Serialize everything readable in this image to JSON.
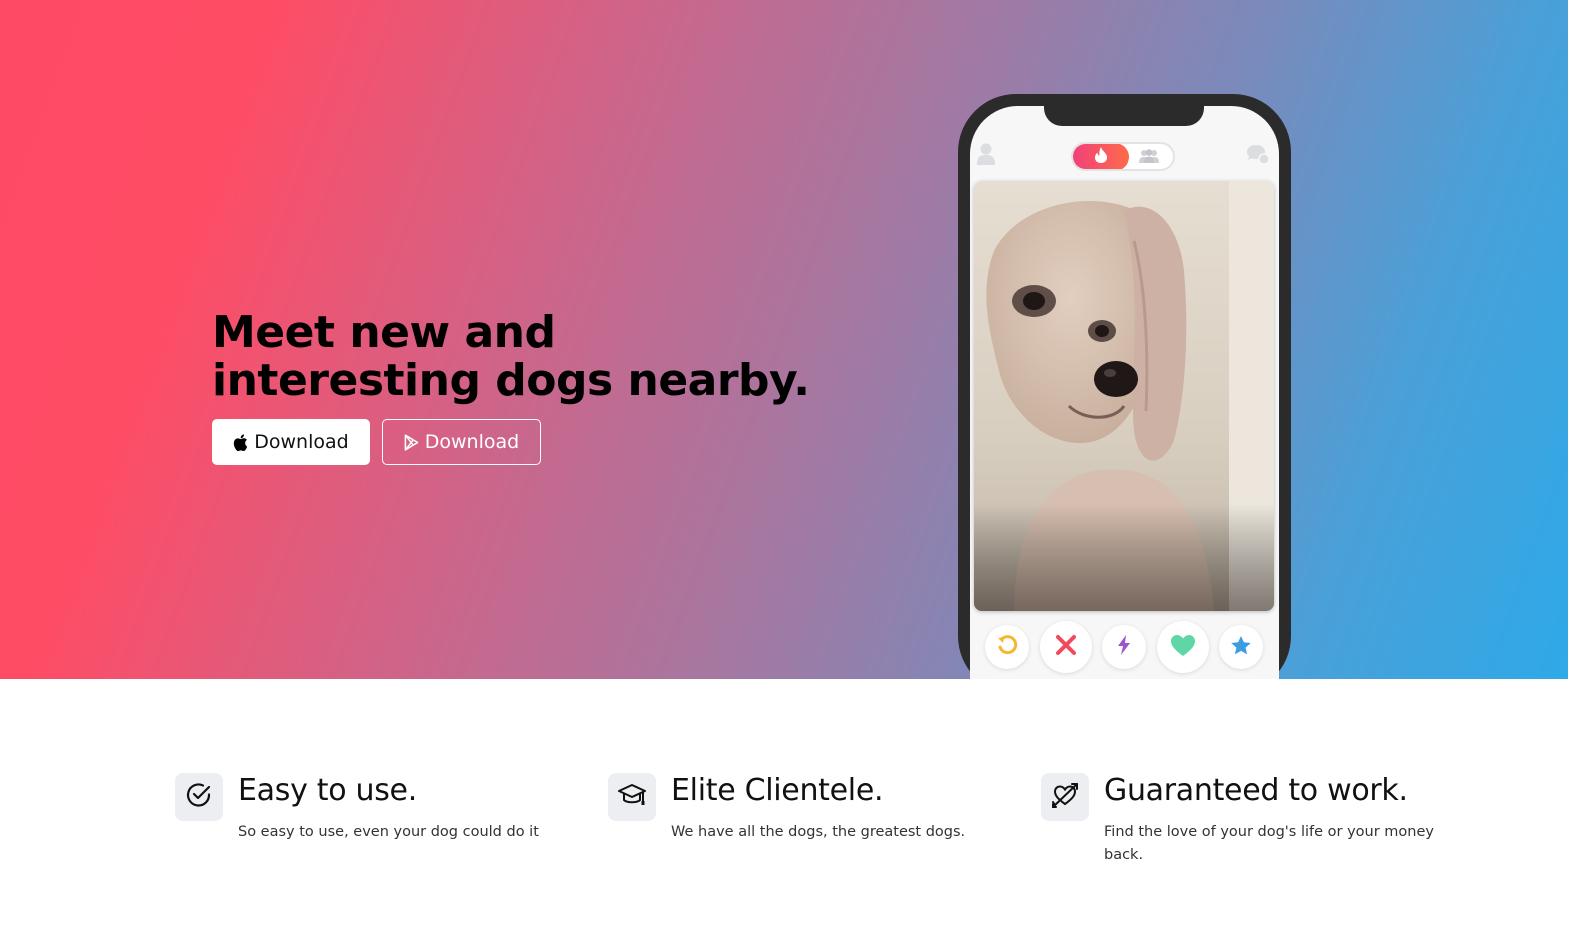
{
  "hero": {
    "title": "Meet new and interesting dogs nearby.",
    "buttons": [
      {
        "label": "Download",
        "icon": "apple-icon"
      },
      {
        "label": "Download",
        "icon": "google-play-icon"
      }
    ],
    "gradient_colors": [
      "#ff4a66",
      "#2ea9e8"
    ]
  },
  "phone": {
    "top_bar": {
      "left_icon": "profile-icon",
      "toggle_active_icon": "flame-icon",
      "toggle_inactive_icon": "group-icon",
      "right_icon": "chat-icon"
    },
    "card": {
      "image": "dog-photo"
    },
    "actions": [
      {
        "icon": "rewind-icon",
        "color": "#f5b731"
      },
      {
        "icon": "close-icon",
        "color": "#f2495c"
      },
      {
        "icon": "boost-icon",
        "color": "#9a55cf"
      },
      {
        "icon": "heart-icon",
        "color": "#5fd6a5"
      },
      {
        "icon": "star-icon",
        "color": "#3c9ee2"
      }
    ]
  },
  "features": [
    {
      "icon": "check-circle-icon",
      "title": "Easy to use.",
      "desc": "So easy to use, even your dog could do it"
    },
    {
      "icon": "graduation-cap-icon",
      "title": "Elite Clientele.",
      "desc": "We have all the dogs, the greatest dogs."
    },
    {
      "icon": "heart-arrow-icon",
      "title": "Guaranteed to work.",
      "desc": "Find the love of your dog's life or your money back."
    }
  ]
}
